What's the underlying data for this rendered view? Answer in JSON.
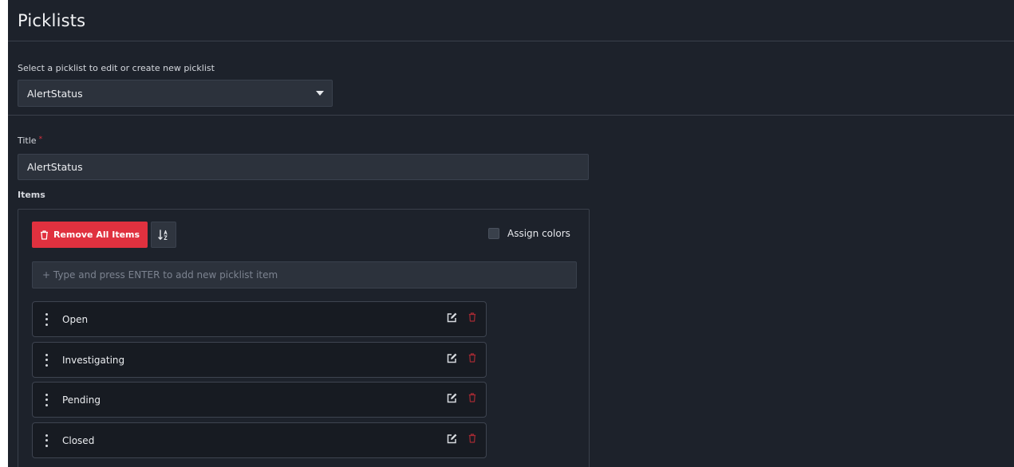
{
  "page": {
    "title": "Picklists"
  },
  "selector": {
    "label": "Select a picklist to edit or create new picklist",
    "selected": "AlertStatus"
  },
  "form": {
    "title_label": "Title",
    "required_mark": "*",
    "title_value": "AlertStatus",
    "items_label": "Items"
  },
  "toolbar": {
    "remove_all_label": "Remove All Items",
    "assign_colors_label": "Assign colors",
    "assign_colors_checked": false
  },
  "add_item": {
    "placeholder": "+ Type and press ENTER to add new picklist item"
  },
  "items": [
    {
      "label": "Open"
    },
    {
      "label": "Investigating"
    },
    {
      "label": "Pending"
    },
    {
      "label": "Closed"
    }
  ],
  "colors": {
    "background": "#1d222b",
    "danger": "#e0313f",
    "input_bg": "#2c323c",
    "item_bg": "#171b22"
  }
}
